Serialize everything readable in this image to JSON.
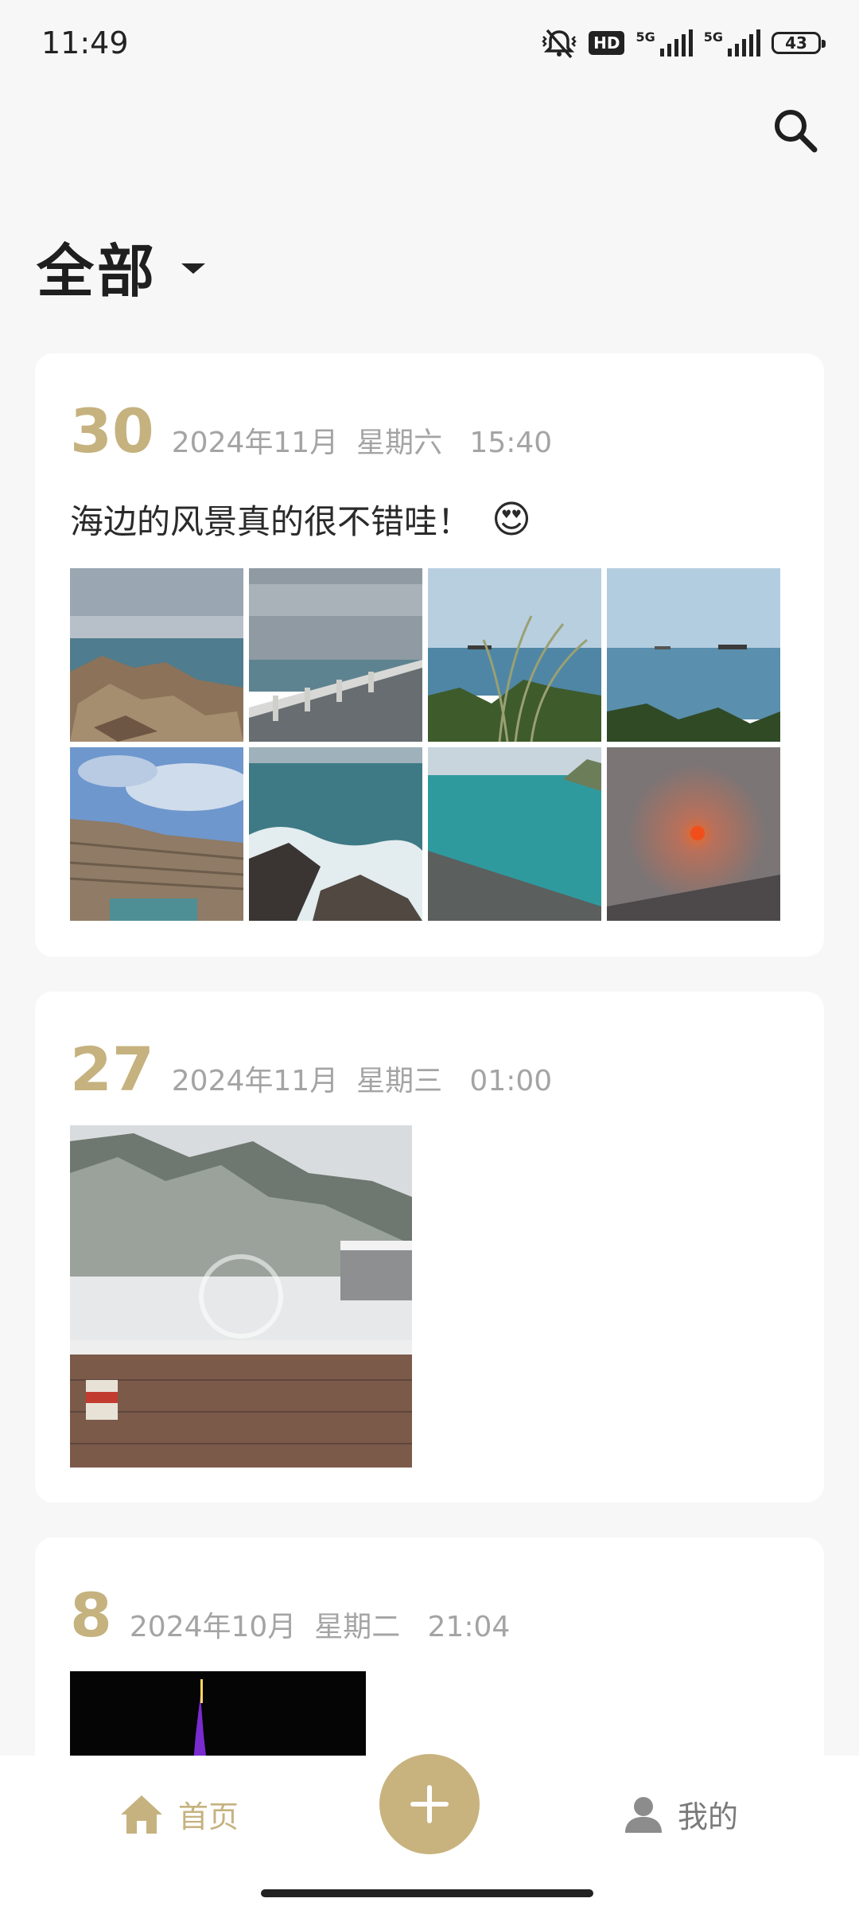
{
  "status_bar": {
    "time": "11:49",
    "hd_label": "HD",
    "network_1": "5G",
    "network_2": "5G",
    "battery": "43"
  },
  "header": {
    "title": "全部",
    "search_icon": "search-icon",
    "dropdown_icon": "caret-down-icon"
  },
  "entries": [
    {
      "day": "30",
      "meta": "2024年11月  星期六   15:40",
      "text": "海边的风景真的很不错哇！",
      "emoji": "😍",
      "photos": [
        "seaside-rocks",
        "cloudy-sea-railing",
        "grass-by-sea",
        "ships-on-sea",
        "quarry-lake",
        "waves-on-rocks",
        "turquoise-sea",
        "foggy-sunset"
      ]
    },
    {
      "day": "27",
      "meta": "2024年11月  星期三   01:00",
      "photos": [
        "snowy-village"
      ]
    },
    {
      "day": "8",
      "meta": "2024年10月  星期二   21:04",
      "photos": [
        "tower-night"
      ]
    }
  ],
  "bottom_nav": {
    "home_label": "首页",
    "mine_label": "我的",
    "add_icon": "plus-icon"
  },
  "colors": {
    "accent": "#c5b27f",
    "background": "#f7f7f7",
    "card": "#ffffff"
  }
}
